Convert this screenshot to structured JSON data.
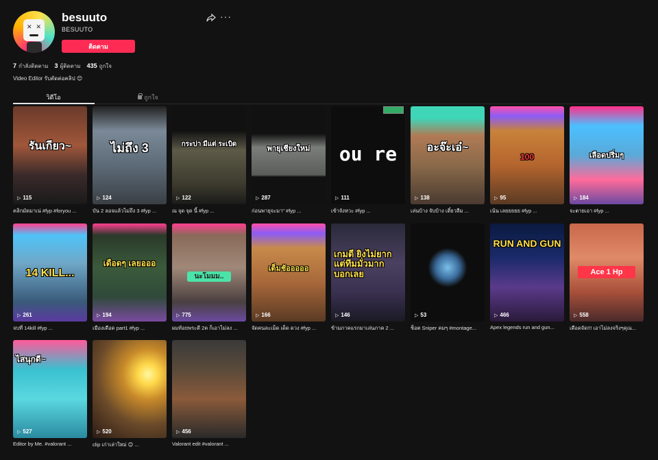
{
  "profile": {
    "username": "besuuto",
    "display_name": "BESUUTO",
    "follow_label": "ติดตาม",
    "following_count": "7",
    "following_label": "กำลังติดตาม",
    "followers_count": "3",
    "followers_label": "ผู้ติดตาม",
    "likes_count": "435",
    "likes_label": "ถูกใจ",
    "bio": "Video Editor รับตัดต่อคลิป 😊"
  },
  "tabs": [
    {
      "label": "วิดีโอ"
    },
    {
      "label": "ถูกใจ"
    }
  ],
  "videos": [
    {
      "views": "115",
      "desc": "คลิกมัดมาเน่ #fyp #foryou ...",
      "caption": "รันเกียว~"
    },
    {
      "views": "124",
      "desc": "บัน 2 ลอจแล้วไม่ถึง 3 #fyp ...",
      "caption": "ไม่ถึง 3"
    },
    {
      "views": "122",
      "desc": "ณ จุด จุด นี้ #fyp ...",
      "caption": "กระบ่า มีแต่ ระเบิด"
    },
    {
      "views": "287",
      "desc": "ก่อนพายุจะมา\" #fyp ...",
      "caption": "พายุเชียงใหม่"
    },
    {
      "views": "111",
      "desc": "เข้าจังหวะ #fyp ...",
      "caption": "ou re"
    },
    {
      "views": "138",
      "desc": "เล่นบ้าง จับบ้าง เดี๋ยวลืม ...",
      "caption": "อะจ๊ะเอ๋~"
    },
    {
      "views": "95",
      "desc": "เน้น เลยยยยย #fyp ...",
      "caption": "100"
    },
    {
      "views": "184",
      "desc": "จะตายเอา #fyp ...",
      "caption": "เลือดปริ่มๆ"
    },
    {
      "views": "261",
      "desc": "จบที่ 14kill #fyp ...",
      "caption": "14 KILL..."
    },
    {
      "views": "194",
      "desc": "เมืองเดือด part1 #fyp ...",
      "caption": "เดือดๆ เลยอออ"
    },
    {
      "views": "775",
      "desc": "ผมท้อยพระดี 2ค ก็เอาไม่ลง ...",
      "caption": "นะโมมม.."
    },
    {
      "views": "166",
      "desc": "จัดคนละเม็ด เด็ด ดวง #fyp ...",
      "caption": "เต็มช้อออออ"
    },
    {
      "views": "146",
      "desc": "ข้ามภาคแรกมาเล่นภาค 2 ...",
      "caption": "เกมดี ยิงไม่ยาก แต่ทีมมั่วมาก บอกเลย"
    },
    {
      "views": "53",
      "desc": "ช็อต Sniper คมๆ #montage...",
      "caption": ""
    },
    {
      "views": "466",
      "desc": "Apex legends run and gun...",
      "caption": "RUN AND GUN"
    },
    {
      "views": "558",
      "desc": "เดือดจัด!!! เอาไม่ลงจริงๆคุณ...",
      "caption": "Ace 1 Hp"
    },
    {
      "views": "527",
      "desc": "Editor by Me. #valorant ...",
      "caption": "ไสนุกดี~"
    },
    {
      "views": "520",
      "desc": "clip เก่าเล่าใหม่ 😊 ...",
      "caption": ""
    },
    {
      "views": "456",
      "desc": "Valorant edit #valorant ...",
      "caption": ""
    }
  ],
  "colors": {
    "accent": "#fe2c55",
    "background": "#121212"
  }
}
